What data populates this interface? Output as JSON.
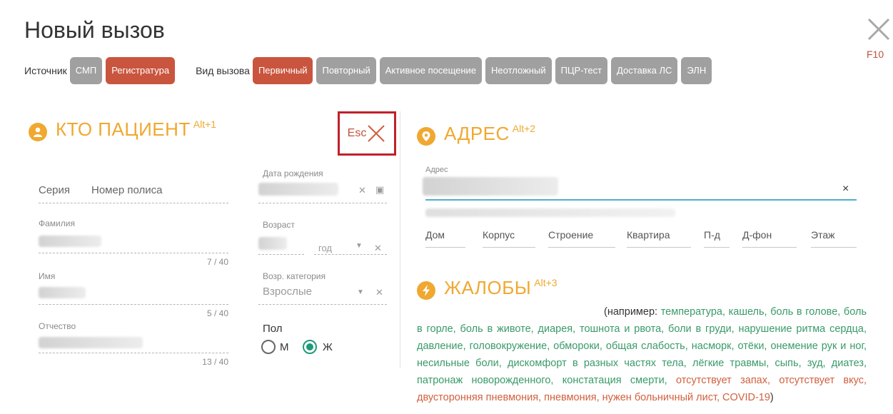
{
  "window": {
    "title": "Новый вызов",
    "close_hotkey": "F10"
  },
  "source": {
    "label": "Источник",
    "options": [
      "СМП",
      "Регистратура"
    ]
  },
  "call_type": {
    "label": "Вид вызова",
    "options": [
      "Первичный",
      "Повторный",
      "Активное посещение",
      "Неотложный",
      "ПЦР-тест",
      "Доставка ЛС",
      "ЭЛН"
    ]
  },
  "patient": {
    "title": "КТО ПАЦИЕНТ",
    "hotkey": "Alt+1",
    "esc_label": "Esc",
    "series_placeholder": "Серия",
    "policy_placeholder": "Номер полиса",
    "birthdate_label": "Дата рождения",
    "surname_label": "Фамилия",
    "surname_counter": "7 / 40",
    "age_label": "Возраст",
    "age_unit": "год",
    "name_label": "Имя",
    "name_counter": "5 / 40",
    "age_category_label": "Возр. категория",
    "age_category_value": "Взрослые",
    "patronymic_label": "Отчество",
    "patronymic_counter": "13 / 40",
    "sex_label": "Пол",
    "sex_male": "М",
    "sex_female": "Ж",
    "sex_selected": "Ж"
  },
  "address": {
    "title": "АДРЕС",
    "hotkey": "Alt+2",
    "field_label": "Адрес",
    "clear": "×",
    "parts": [
      "Дом",
      "Корпус",
      "Строение",
      "Квартира",
      "П-д",
      "Д-фон",
      "Этаж"
    ]
  },
  "complaints": {
    "title": "ЖАЛОБЫ",
    "hotkey": "Alt+3",
    "intro": "(например:",
    "green_text": "температура, кашель, боль в голове, боль в горле, боль в животе, диарея, тошнота и рвота, боли в груди, нарушение ритма сердца, давление, головокружение, обмороки, общая слабость, насморк, отёки, онемение рук и ног, несильные боли, дискомфорт в разных частях тела, лёгкие травмы, сыпь, зуд, диатез, патронаж новорожденного, констатация смерти,",
    "red_text": "отсутствует запах, отсутствует вкус, двусторонняя пневмония, пневмония, нужен больничный лист, COVID-19",
    "close_paren": ")"
  },
  "colors": {
    "accent": "#f0a830",
    "chip_active": "#c9553e",
    "chip_inactive": "#a0a0a0",
    "highlight_box": "#c0202a",
    "complaint_green": "#3a9a6a",
    "complaint_red": "#d0603e"
  }
}
